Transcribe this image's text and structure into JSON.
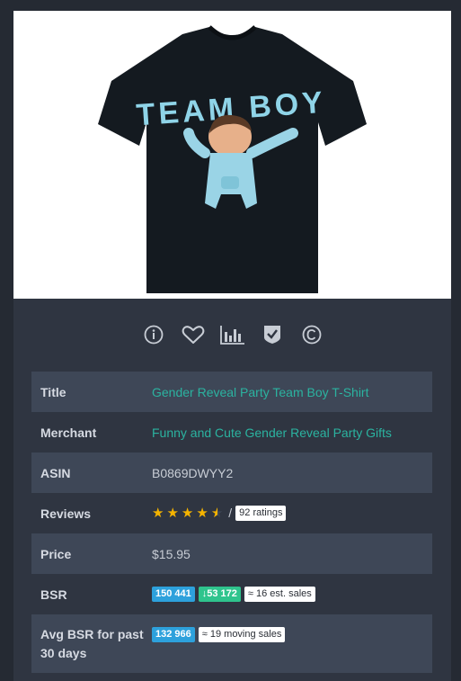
{
  "product": {
    "shirt_text": "TEAM BOY"
  },
  "toolbar": {
    "icons": [
      "info-icon",
      "heart-icon",
      "bar-chart-icon",
      "shield-check-icon",
      "copyright-icon"
    ]
  },
  "details": {
    "title": {
      "label": "Title",
      "value": "Gender Reveal Party Team Boy T-Shirt"
    },
    "merchant": {
      "label": "Merchant",
      "value": "Funny and Cute Gender Reveal Party Gifts"
    },
    "asin": {
      "label": "ASIN",
      "value": "B0869DWYY2"
    },
    "reviews": {
      "label": "Reviews",
      "rating": 4.5,
      "slash": "/",
      "ratings_count": "92 ratings"
    },
    "price": {
      "label": "Price",
      "value": "$15.95"
    },
    "bsr": {
      "label": "BSR",
      "rank": "150 441",
      "change": "↓53 172",
      "est_sales": "≈ 16 est. sales"
    },
    "avg_bsr": {
      "label_line1": "Avg BSR for past",
      "label_line2": "30 days",
      "rank": "132 966",
      "moving_sales": "≈ 19 moving sales"
    }
  },
  "colors": {
    "link": "#2bb3a0",
    "star": "#f5b400",
    "pill_blue": "#2da1dc",
    "pill_green": "#2fc48d"
  }
}
